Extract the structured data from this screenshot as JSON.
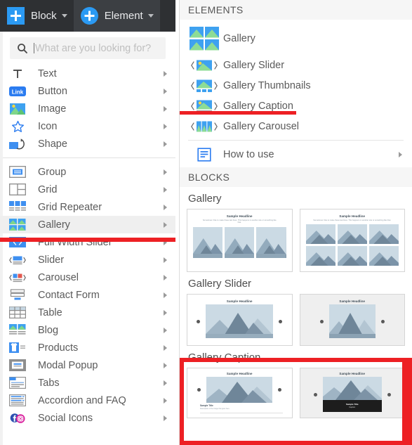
{
  "toolbar": {
    "block_button": {
      "label": "Block",
      "icon": "plus-square-icon"
    },
    "element_button": {
      "label": "Element",
      "icon": "plus-circle-icon",
      "active": true
    }
  },
  "search": {
    "placeholder": "What are you looking for?",
    "value": "",
    "icon": "search-icon"
  },
  "sidebar": {
    "group1": [
      {
        "label": "Text",
        "icon": "text-t-icon"
      },
      {
        "label": "Button",
        "icon": "link-button-icon"
      },
      {
        "label": "Image",
        "icon": "image-icon"
      },
      {
        "label": "Icon",
        "icon": "star-icon"
      },
      {
        "label": "Shape",
        "icon": "shape-icon"
      }
    ],
    "group2": [
      {
        "label": "Group",
        "icon": "group-icon"
      },
      {
        "label": "Grid",
        "icon": "grid-icon"
      },
      {
        "label": "Grid Repeater",
        "icon": "grid-repeater-icon"
      },
      {
        "label": "Gallery",
        "icon": "gallery-icon",
        "selected": true
      },
      {
        "label": "Full Width Slider",
        "icon": "full-width-slider-icon"
      },
      {
        "label": "Slider",
        "icon": "slider-icon"
      },
      {
        "label": "Carousel",
        "icon": "carousel-icon"
      },
      {
        "label": "Contact Form",
        "icon": "contact-form-icon"
      },
      {
        "label": "Table",
        "icon": "table-icon"
      },
      {
        "label": "Blog",
        "icon": "blog-icon"
      },
      {
        "label": "Products",
        "icon": "products-icon"
      },
      {
        "label": "Modal Popup",
        "icon": "modal-popup-icon"
      },
      {
        "label": "Tabs",
        "icon": "tabs-icon"
      },
      {
        "label": "Accordion and FAQ",
        "icon": "accordion-faq-icon"
      },
      {
        "label": "Social Icons",
        "icon": "social-icons-icon"
      }
    ]
  },
  "panel": {
    "elements_header": "ELEMENTS",
    "blocks_header": "BLOCKS",
    "elements": [
      {
        "label": "Gallery",
        "icon": "gallery-grid-icon"
      },
      {
        "label": "Gallery Slider",
        "icon": "gallery-slider-icon"
      },
      {
        "label": "Gallery Thumbnails",
        "icon": "gallery-thumbnails-icon"
      },
      {
        "label": "Gallery Caption",
        "icon": "gallery-caption-icon",
        "annotated": true
      },
      {
        "label": "Gallery Carousel",
        "icon": "gallery-carousel-icon"
      }
    ],
    "how_to_use": {
      "label": "How to use",
      "icon": "how-to-use-icon"
    },
    "blocks": [
      {
        "title": "Gallery",
        "thumbs": [
          {
            "headline": "Sample Headline",
            "subtext": "Sometimes I like to make these last lines. This happens in another site or something like that.",
            "layout": "grid3"
          },
          {
            "headline": "Sample Headline",
            "subtext": "Sometimes I like to make these last lines. This happens in another site or something like that.",
            "layout": "grid6"
          }
        ]
      },
      {
        "title": "Gallery Slider",
        "thumbs": [
          {
            "headline": "Sample Headline",
            "layout": "slider-light"
          },
          {
            "headline": "Sample Headline",
            "layout": "slider-grey"
          }
        ]
      },
      {
        "title": "Gallery Caption",
        "annotated": true,
        "thumbs": [
          {
            "headline": "Sample Headline",
            "caption_title": "Sample Title",
            "caption_text": "Description of the image that goes here.",
            "layout": "caption-light"
          },
          {
            "headline": "Sample Headline",
            "caption_title": "Sample Title",
            "caption_text": "Caption",
            "layout": "caption-dark"
          }
        ]
      }
    ]
  },
  "colors": {
    "accent_blue": "#2b9af3",
    "annotation_red": "#ed2024",
    "topbar_dark": "#2e3033",
    "selected_row": "#efefef"
  }
}
